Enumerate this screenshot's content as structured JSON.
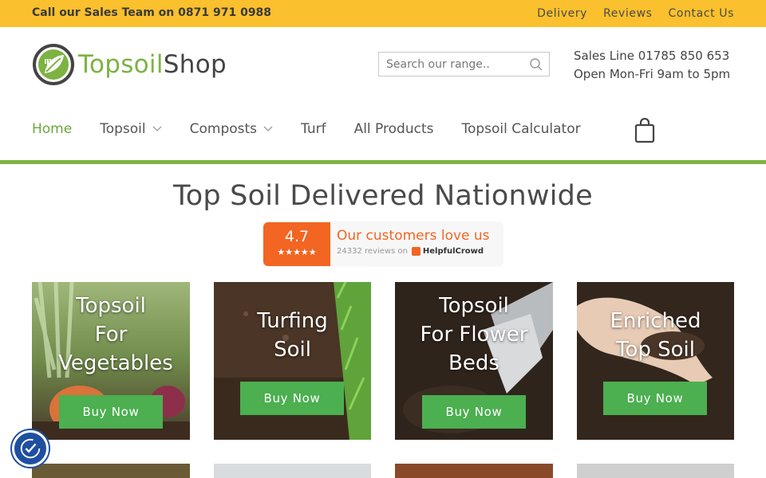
{
  "topbar": {
    "call_text": "Call our Sales Team on 0871 971 0988",
    "links": [
      "Delivery",
      "Reviews",
      "Contact Us"
    ]
  },
  "logo": {
    "part1": "Topsoil",
    "part2": "Shop"
  },
  "search": {
    "placeholder": "Search our range.."
  },
  "sales": {
    "line1": "Sales Line 01785 850 653",
    "line2": "Open Mon-Fri 9am to 5pm"
  },
  "nav": {
    "items": [
      {
        "label": "Home"
      },
      {
        "label": "Topsoil"
      },
      {
        "label": "Composts"
      },
      {
        "label": "Turf"
      },
      {
        "label": "All Products"
      },
      {
        "label": "Topsoil Calculator"
      }
    ]
  },
  "hero": {
    "title": "Top Soil Delivered Nationwide"
  },
  "reviews": {
    "score": "4.7",
    "stars": "★★★★★",
    "headline": "Our customers love us",
    "count_text": "24332 reviews on",
    "provider": "HelpfulCrowd"
  },
  "products": [
    {
      "title_lines": [
        "Topsoil",
        "For",
        "Vegetables"
      ],
      "button": "Buy Now"
    },
    {
      "title_lines": [
        "Turfing",
        "Soil"
      ],
      "button": "Buy Now"
    },
    {
      "title_lines": [
        "Topsoil",
        "For Flower",
        "Beds"
      ],
      "button": "Buy Now"
    },
    {
      "title_lines": [
        "Enriched",
        "Top Soil"
      ],
      "button": "Buy Now"
    }
  ],
  "colors": {
    "topbar": "#fbc02d",
    "brand_green": "#7cb342",
    "button_green": "#4caf50",
    "review_orange": "#f26522",
    "a11y_blue": "#1f4fa0"
  },
  "icons": {
    "search": "search-icon",
    "cart": "shopping-bag-icon",
    "chevron": "chevron-down-icon",
    "accessibility": "accessibility-icon"
  }
}
